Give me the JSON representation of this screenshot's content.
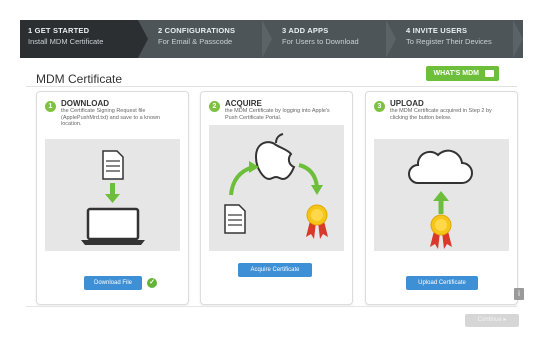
{
  "wizard": {
    "steps": [
      {
        "title": "1 GET STARTED",
        "subtitle": "Install MDM Certificate"
      },
      {
        "title": "2 CONFIGURATIONS",
        "subtitle": "For Email & Passcode"
      },
      {
        "title": "3 ADD APPS",
        "subtitle": "For Users to Download"
      },
      {
        "title": "4 INVITE USERS",
        "subtitle": "To Register Their Devices"
      }
    ]
  },
  "header": {
    "title": "MDM Certificate",
    "video_label": "WHAT'S MDM"
  },
  "panels": [
    {
      "number": "1",
      "heading": "DOWNLOAD",
      "desc": "the Certificate Signing Request file (ApplePushMrd.txt) and save to a known location.",
      "button": "Download File"
    },
    {
      "number": "2",
      "heading": "ACQUIRE",
      "desc": "the MDM Certificate by logging into Apple's Push Certificate Portal.",
      "button": "Acquire Certificate"
    },
    {
      "number": "3",
      "heading": "UPLOAD",
      "desc": "the MDM Certificate acquired in Step 2 by clicking the button below.",
      "button": "Upload Certificate"
    }
  ],
  "footer": {
    "help": "i",
    "continue_label": "Continue ▸"
  },
  "colors": {
    "accent_green": "#6dbf3b",
    "button_blue": "#3d8fd6",
    "wizard_bg": "#4e5559",
    "wizard_active": "#2b2f31"
  }
}
